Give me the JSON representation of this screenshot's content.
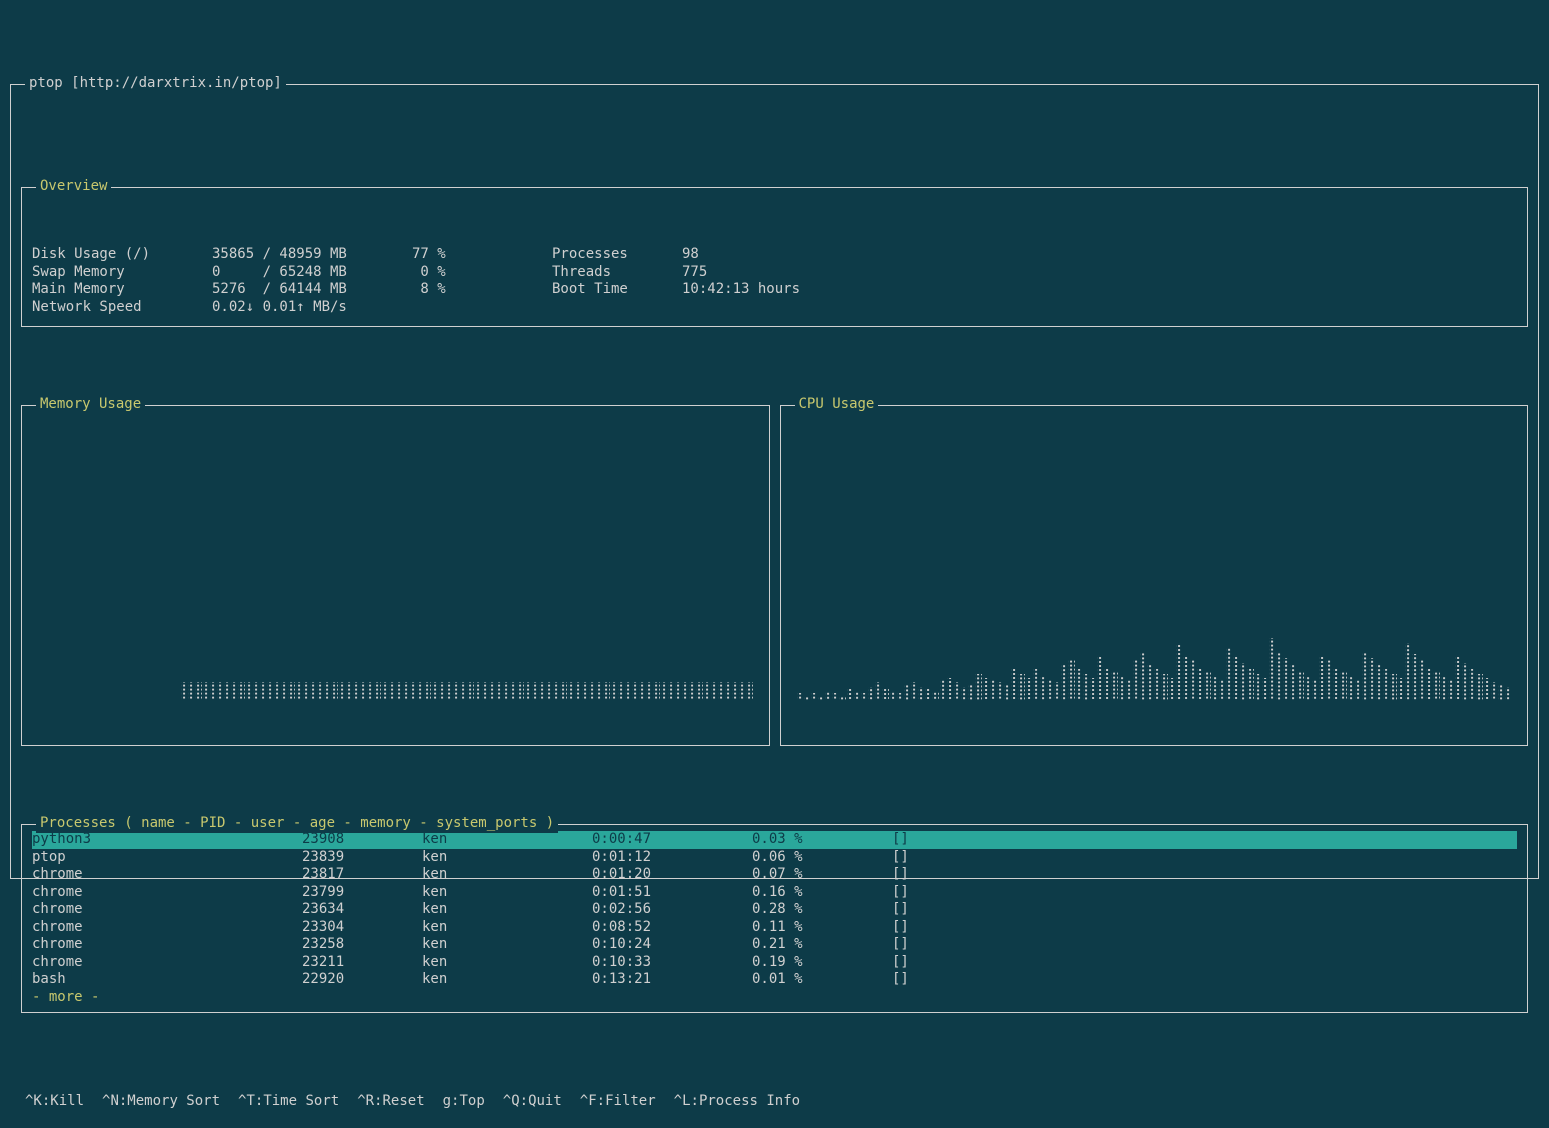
{
  "window_title": "ptop [http://darxtrix.in/ptop]",
  "overview": {
    "title": "Overview",
    "rows": [
      {
        "label": "Disk Usage (/)",
        "value": "35865 / 48959 MB",
        "pct": "77 %",
        "label2": "Processes",
        "value2": "98"
      },
      {
        "label": "Swap Memory",
        "value": "0     / 65248 MB",
        "pct": " 0 %",
        "label2": "Threads",
        "value2": "775"
      },
      {
        "label": "Main Memory",
        "value": "5276  / 64144 MB",
        "pct": " 8 %",
        "label2": "Boot Time",
        "value2": "10:42:13 hours"
      },
      {
        "label": "Network Speed",
        "value": "0.02↓ 0.01↑ MB/s",
        "pct": "",
        "label2": "",
        "value2": ""
      }
    ]
  },
  "mem_panel_title": "Memory Usage",
  "cpu_panel_title": "CPU Usage",
  "chart_data": [
    {
      "type": "bar",
      "name": "memory_usage",
      "ylim": [
        0,
        100
      ],
      "values": [
        0,
        0,
        0,
        0,
        0,
        0,
        0,
        0,
        0,
        0,
        0,
        0,
        0,
        0,
        0,
        0,
        0,
        0,
        0,
        0,
        8,
        8,
        8,
        8,
        8,
        8,
        8,
        8,
        8,
        8,
        8,
        8,
        8,
        8,
        8,
        8,
        8,
        8,
        8,
        8,
        8,
        8,
        8,
        8,
        8,
        8,
        8,
        8,
        8,
        8,
        8,
        8,
        8,
        8,
        8,
        8,
        8,
        8,
        8,
        8,
        8,
        8,
        8,
        8,
        8,
        8,
        8,
        8,
        8,
        8,
        8,
        8,
        8,
        8,
        8,
        8,
        8,
        8,
        8,
        8,
        8,
        8,
        8,
        8,
        8,
        8,
        8,
        8,
        8,
        8,
        8,
        8,
        8,
        8,
        8,
        8,
        8,
        8,
        8,
        8
      ]
    },
    {
      "type": "bar",
      "name": "cpu_usage",
      "ylim": [
        0,
        100
      ],
      "values": [
        3,
        2,
        3,
        2,
        4,
        3,
        2,
        5,
        4,
        3,
        6,
        8,
        5,
        4,
        3,
        7,
        8,
        6,
        5,
        4,
        9,
        10,
        8,
        6,
        7,
        12,
        10,
        9,
        8,
        7,
        15,
        12,
        10,
        14,
        11,
        9,
        8,
        16,
        18,
        14,
        12,
        10,
        20,
        15,
        13,
        11,
        9,
        18,
        22,
        16,
        14,
        12,
        10,
        25,
        20,
        18,
        15,
        13,
        11,
        9,
        24,
        20,
        17,
        14,
        12,
        10,
        28,
        22,
        19,
        16,
        13,
        11,
        9,
        20,
        18,
        15,
        13,
        11,
        9,
        22,
        19,
        16,
        14,
        12,
        10,
        26,
        21,
        18,
        15,
        13,
        11,
        9,
        20,
        17,
        14,
        12,
        10,
        8,
        7,
        6
      ]
    }
  ],
  "processes": {
    "title": "Processes ( name - PID - user - age - memory - system_ports )",
    "more": "- more -",
    "rows": [
      {
        "name": "python3",
        "pid": "23908",
        "user": "ken",
        "age": "0:00:47",
        "mem": "0.03 %",
        "ports": "[]",
        "selected": true
      },
      {
        "name": "ptop",
        "pid": "23839",
        "user": "ken",
        "age": "0:01:12",
        "mem": "0.06 %",
        "ports": "[]",
        "selected": false
      },
      {
        "name": "chrome",
        "pid": "23817",
        "user": "ken",
        "age": "0:01:20",
        "mem": "0.07 %",
        "ports": "[]",
        "selected": false
      },
      {
        "name": "chrome",
        "pid": "23799",
        "user": "ken",
        "age": "0:01:51",
        "mem": "0.16 %",
        "ports": "[]",
        "selected": false
      },
      {
        "name": "chrome",
        "pid": "23634",
        "user": "ken",
        "age": "0:02:56",
        "mem": "0.28 %",
        "ports": "[]",
        "selected": false
      },
      {
        "name": "chrome",
        "pid": "23304",
        "user": "ken",
        "age": "0:08:52",
        "mem": "0.11 %",
        "ports": "[]",
        "selected": false
      },
      {
        "name": "chrome",
        "pid": "23258",
        "user": "ken",
        "age": "0:10:24",
        "mem": "0.21 %",
        "ports": "[]",
        "selected": false
      },
      {
        "name": "chrome",
        "pid": "23211",
        "user": "ken",
        "age": "0:10:33",
        "mem": "0.19 %",
        "ports": "[]",
        "selected": false
      },
      {
        "name": "bash",
        "pid": "22920",
        "user": "ken",
        "age": "0:13:21",
        "mem": "0.01 %",
        "ports": "[]",
        "selected": false
      }
    ]
  },
  "hotkeys": [
    "^K:Kill",
    "^N:Memory Sort",
    "^T:Time Sort",
    "^R:Reset",
    "g:Top",
    "^Q:Quit",
    "^F:Filter",
    "^L:Process Info"
  ]
}
